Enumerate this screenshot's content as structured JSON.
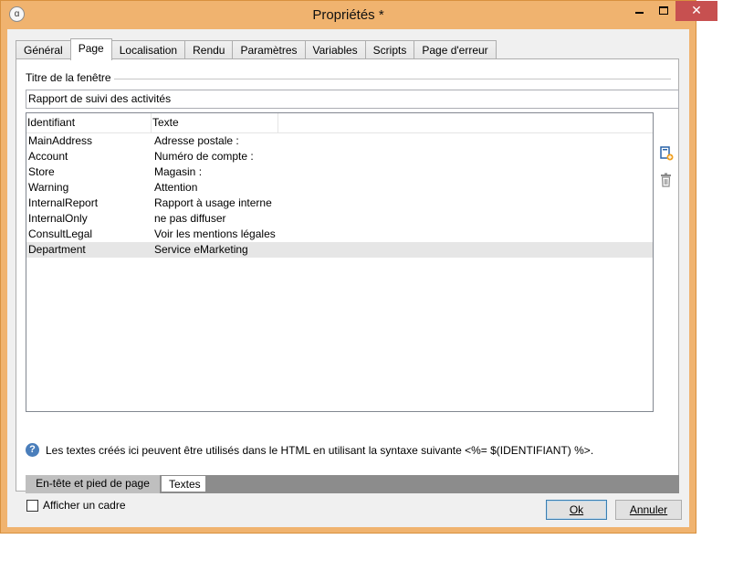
{
  "window": {
    "title": "Propriétés *",
    "app_icon_glyph": "ɑ",
    "close_glyph": "✕"
  },
  "tabs": [
    {
      "label": "Général"
    },
    {
      "label": "Page"
    },
    {
      "label": "Localisation"
    },
    {
      "label": "Rendu"
    },
    {
      "label": "Paramètres"
    },
    {
      "label": "Variables"
    },
    {
      "label": "Scripts"
    },
    {
      "label": "Page d'erreur"
    }
  ],
  "active_tab": "Page",
  "window_title_group": {
    "label": "Titre de la fenêtre",
    "value": "Rapport de suivi des activités"
  },
  "table": {
    "columns": [
      "Identifiant",
      "Texte"
    ],
    "rows": [
      {
        "id": "MainAddress",
        "text": "Adresse postale :"
      },
      {
        "id": "Account",
        "text": "Numéro de compte :"
      },
      {
        "id": "Store",
        "text": "Magasin :"
      },
      {
        "id": "Warning",
        "text": "Attention"
      },
      {
        "id": "InternalReport",
        "text": "Rapport à usage interne"
      },
      {
        "id": "InternalOnly",
        "text": "ne pas diffuser"
      },
      {
        "id": "ConsultLegal",
        "text": "Voir les mentions légales"
      },
      {
        "id": "Department",
        "text": "Service eMarketing"
      }
    ],
    "selected_row": "Department"
  },
  "side_icons": [
    "add-icon",
    "trash-icon"
  ],
  "help": {
    "icon": "?",
    "text": "Les textes créés ici peuvent être utilisés dans le HTML en utilisant la syntaxe suivante <%= $(IDENTIFIANT) %>."
  },
  "subtabs": [
    {
      "label": "En-tête et pied de page"
    },
    {
      "label": "Textes"
    }
  ],
  "active_subtab": "Textes",
  "checkbox": {
    "label": "Afficher un cadre",
    "checked": false
  },
  "buttons": {
    "ok": "Ok",
    "cancel": "Annuler"
  },
  "colors": {
    "frame": "#f0b36f",
    "close": "#c75050",
    "help": "#4a7ebb"
  }
}
